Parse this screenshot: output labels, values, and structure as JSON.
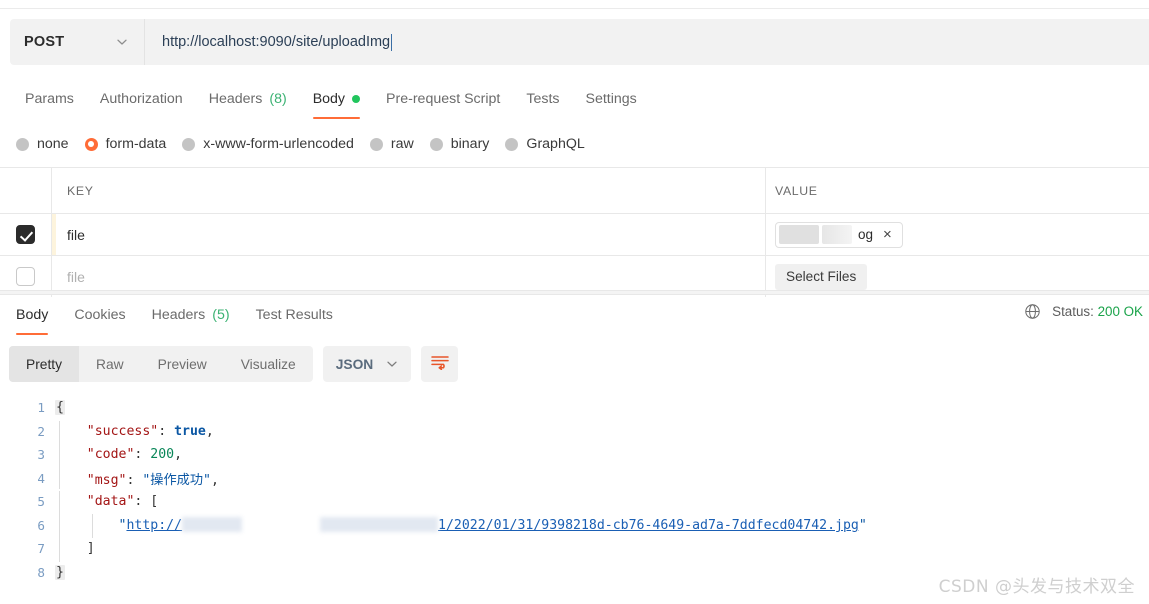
{
  "request": {
    "method": "POST",
    "method_icon": "chevron-down-icon",
    "url": "http://localhost:9090/site/uploadImg",
    "tabs": [
      {
        "label": "Params",
        "active": false,
        "count": null,
        "dot": false
      },
      {
        "label": "Authorization",
        "active": false,
        "count": null,
        "dot": false
      },
      {
        "label": "Headers",
        "active": false,
        "count": "(8)",
        "dot": false
      },
      {
        "label": "Body",
        "active": true,
        "count": null,
        "dot": true
      },
      {
        "label": "Pre-request Script",
        "active": false,
        "count": null,
        "dot": false
      },
      {
        "label": "Tests",
        "active": false,
        "count": null,
        "dot": false
      },
      {
        "label": "Settings",
        "active": false,
        "count": null,
        "dot": false
      }
    ],
    "body_types": [
      {
        "label": "none",
        "selected": false
      },
      {
        "label": "form-data",
        "selected": true
      },
      {
        "label": "x-www-form-urlencoded",
        "selected": false
      },
      {
        "label": "raw",
        "selected": false
      },
      {
        "label": "binary",
        "selected": false
      },
      {
        "label": "GraphQL",
        "selected": false
      }
    ],
    "table": {
      "headers": {
        "key": "KEY",
        "value": "VALUE"
      },
      "rows": [
        {
          "checked": true,
          "key": "file",
          "key_is_placeholder": false,
          "value_type": "file-chip",
          "chip_text": "og",
          "chip_remove_label": "×",
          "select_files_label": null
        },
        {
          "checked": false,
          "key": "file",
          "key_is_placeholder": true,
          "value_type": "select-files",
          "chip_text": null,
          "chip_remove_label": null,
          "select_files_label": "Select Files"
        }
      ]
    }
  },
  "response": {
    "tabs": [
      {
        "label": "Body",
        "active": true,
        "count": null
      },
      {
        "label": "Cookies",
        "active": false,
        "count": null
      },
      {
        "label": "Headers",
        "active": false,
        "count": "(5)"
      },
      {
        "label": "Test Results",
        "active": false,
        "count": null
      }
    ],
    "status_icon": "globe-icon",
    "status_label": "Status:",
    "status_value": "200 OK",
    "view_modes": [
      {
        "label": "Pretty",
        "active": true
      },
      {
        "label": "Raw",
        "active": false
      },
      {
        "label": "Preview",
        "active": false
      },
      {
        "label": "Visualize",
        "active": false
      }
    ],
    "format": "JSON",
    "format_icon": "chevron-down-icon",
    "wrap_icon": "wrap-lines-icon",
    "code": {
      "line_numbers": [
        "1",
        "2",
        "3",
        "4",
        "5",
        "6",
        "7",
        "8"
      ],
      "lines": [
        {
          "n": "1",
          "tokens": [
            {
              "t": "{",
              "c": "fold"
            }
          ]
        },
        {
          "n": "2",
          "tokens": [
            {
              "t": "    \"success\"",
              "c": "k"
            },
            {
              "t": ": ",
              "c": "pun"
            },
            {
              "t": "true",
              "c": "bool"
            },
            {
              "t": ",",
              "c": "pun"
            }
          ]
        },
        {
          "n": "3",
          "tokens": [
            {
              "t": "    \"code\"",
              "c": "k"
            },
            {
              "t": ": ",
              "c": "pun"
            },
            {
              "t": "200",
              "c": "num"
            },
            {
              "t": ",",
              "c": "pun"
            }
          ]
        },
        {
          "n": "4",
          "tokens": [
            {
              "t": "    \"msg\"",
              "c": "k"
            },
            {
              "t": ": ",
              "c": "pun"
            },
            {
              "t": "\"操作成功\"",
              "c": "str"
            },
            {
              "t": ",",
              "c": "pun"
            }
          ]
        },
        {
          "n": "5",
          "tokens": [
            {
              "t": "    \"data\"",
              "c": "k"
            },
            {
              "t": ": [",
              "c": "pun"
            }
          ]
        },
        {
          "n": "6",
          "tokens": [
            {
              "t": "        \"",
              "c": "str"
            },
            {
              "t": "http://",
              "c": "link"
            },
            {
              "t": "REDACTED",
              "c": "blur"
            },
            {
              "t": "1/2022/01/31/9398218d-cb76-4649-ad7a-7ddfecd04742.jpg",
              "c": "link"
            },
            {
              "t": "\"",
              "c": "str"
            }
          ]
        },
        {
          "n": "7",
          "tokens": [
            {
              "t": "    ]",
              "c": "pun"
            }
          ]
        },
        {
          "n": "8",
          "tokens": [
            {
              "t": "}",
              "c": "fold"
            }
          ]
        }
      ],
      "redacted_host": "REDACTED"
    }
  },
  "watermark": "CSDN @头发与技术双全",
  "colors": {
    "accent": "#ff6c37",
    "success_green": "#21c55d",
    "status_green": "#1aa34a",
    "count_green": "#3bb273",
    "link_blue": "#1a5fb4"
  }
}
